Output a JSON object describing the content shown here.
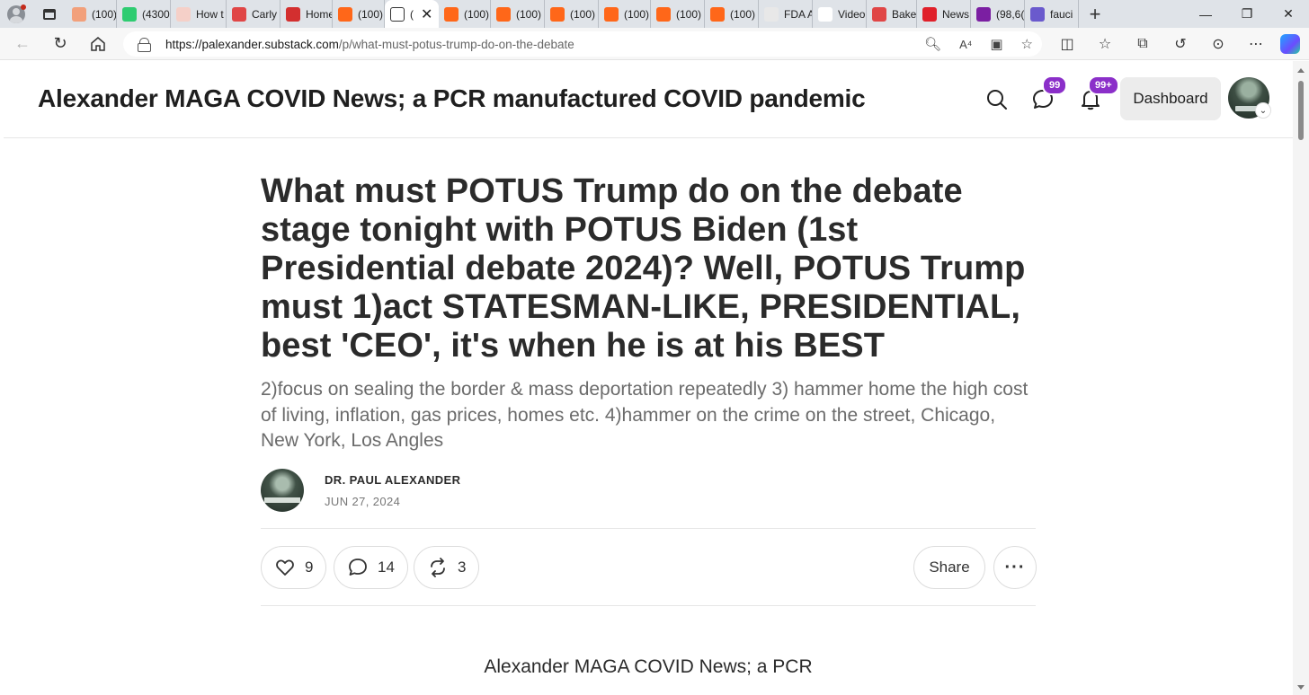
{
  "browser": {
    "tabs": [
      {
        "label": "(100)",
        "color": "#f2a07b"
      },
      {
        "label": "(4300",
        "color": "#2ecc71"
      },
      {
        "label": "How t",
        "color": "#f5d0c8"
      },
      {
        "label": "Carly",
        "color": "#e04646"
      },
      {
        "label": "Home",
        "color": "#d32f2f"
      },
      {
        "label": "(100)",
        "color": "#ff6719"
      },
      {
        "label": "(",
        "color": "#ffffff",
        "active": true
      },
      {
        "label": "(100)",
        "color": "#ff6719"
      },
      {
        "label": "(100)",
        "color": "#ff6719"
      },
      {
        "label": "(100)",
        "color": "#ff6719"
      },
      {
        "label": "(100)",
        "color": "#ff6719"
      },
      {
        "label": "(100)",
        "color": "#ff6719"
      },
      {
        "label": "(100)",
        "color": "#ff6719"
      },
      {
        "label": "FDA A",
        "color": "#e8e8e8"
      },
      {
        "label": "Video",
        "color": "#ffffff"
      },
      {
        "label": "Baker",
        "color": "#e04646"
      },
      {
        "label": "News",
        "color": "#e0202a"
      },
      {
        "label": "(98,6(",
        "color": "#7b1fa2"
      },
      {
        "label": "fauci",
        "color": "#6a5acd"
      }
    ],
    "url_domain": "https://palexander.substack.com",
    "url_path": "/p/what-must-potus-trump-do-on-the-debate"
  },
  "header": {
    "site_title": "Alexander MAGA COVID News; a PCR manufactured COVID pandemic",
    "chat_badge": "99",
    "notif_badge": "99+",
    "dashboard_label": "Dashboard"
  },
  "post": {
    "title": "What must POTUS Trump do on the debate stage tonight with POTUS Biden (1st Presidential debate 2024)? Well, POTUS Trump must 1)act STATESMAN-LIKE, PRESIDENTIAL, best 'CEO', it's when he is at his BEST",
    "subtitle": "2)focus on sealing the border & mass deportation repeatedly 3) hammer home the high cost of living, inflation, gas prices, homes etc. 4)hammer on the crime on the street, Chicago, New York, Los Angles",
    "author": "DR. PAUL ALEXANDER",
    "date": "JUN 27, 2024",
    "likes": "9",
    "comments": "14",
    "restacks": "3",
    "share_label": "Share",
    "body_lead": "Alexander MAGA COVID News; a PCR"
  }
}
